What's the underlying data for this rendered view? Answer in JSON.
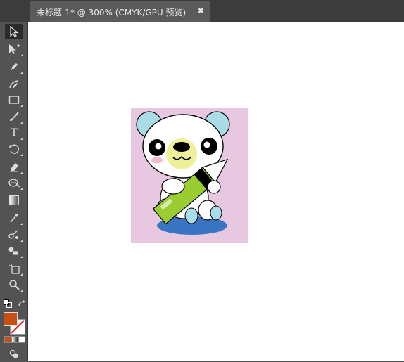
{
  "document_tab": {
    "title": "未标题-1* @ 300% (CMYK/GPU 预览)",
    "close_glyph": "✖"
  },
  "toolbar": {
    "tools": [
      {
        "name": "selection-tool-icon",
        "active": true
      },
      {
        "name": "direct-selection-tool-icon"
      },
      {
        "name": "pen-tool-icon"
      },
      {
        "name": "curvature-tool-icon"
      },
      {
        "name": "rectangle-tool-icon"
      },
      {
        "name": "paintbrush-tool-icon"
      },
      {
        "name": "type-tool-icon",
        "glyph": "T"
      },
      {
        "name": "rotate-tool-icon"
      },
      {
        "name": "eraser-tool-icon"
      },
      {
        "name": "warp-tool-icon"
      },
      {
        "name": "gradient-tool-icon"
      },
      {
        "name": "eyedropper-tool-icon"
      },
      {
        "name": "blend-tool-icon"
      },
      {
        "name": "shape-builder-tool-icon"
      },
      {
        "name": "artboard-tool-icon"
      },
      {
        "name": "zoom-tool-icon"
      }
    ],
    "fill_color": "#c84f14",
    "stroke": "none"
  },
  "colors": {
    "artboard_background": "#e8c8e0",
    "bear_ear": "#a8dce6",
    "bear_muzzle": "#f0f09a",
    "pencil_body": "#9acd32",
    "shadow": "#3a75c4",
    "cheek": "#f4b8d0"
  }
}
